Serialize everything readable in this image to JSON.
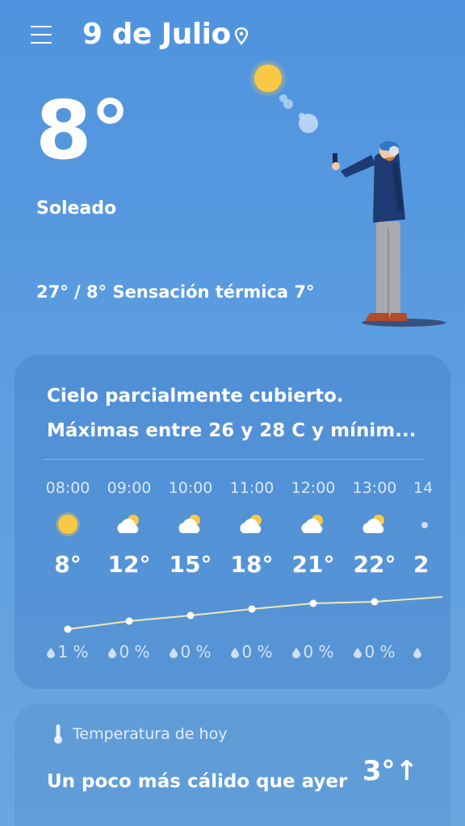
{
  "header": {
    "city": "9 de Julio",
    "menu_icon": "hamburger-menu-icon",
    "location_icon": "map-pin-icon"
  },
  "current": {
    "temperature": "8°",
    "condition": "Soleado",
    "range_feels_like": "27° / 8° Sensación térmica 7°"
  },
  "forecast_card": {
    "summary_line1": "Cielo parcialmente cubierto.",
    "summary_line2": "Máximas entre 26 y 28 C y mínim...",
    "hours": [
      {
        "time": "08:00",
        "icon": "sun-icon",
        "temp": "8°",
        "precip": "1 %"
      },
      {
        "time": "09:00",
        "icon": "partly-cloudy-icon",
        "temp": "12°",
        "precip": "0 %"
      },
      {
        "time": "10:00",
        "icon": "partly-cloudy-icon",
        "temp": "15°",
        "precip": "0 %"
      },
      {
        "time": "11:00",
        "icon": "partly-cloudy-icon",
        "temp": "18°",
        "precip": "0 %"
      },
      {
        "time": "12:00",
        "icon": "partly-cloudy-icon",
        "temp": "21°",
        "precip": "0 %"
      },
      {
        "time": "13:00",
        "icon": "partly-cloudy-icon",
        "temp": "22°",
        "precip": "0 %"
      },
      {
        "time": "14",
        "icon": "partly-cloudy-icon",
        "temp": "2",
        "precip": ""
      }
    ]
  },
  "today_card": {
    "title": "Temperatura de hoy",
    "text": "Un poco más cálido que ayer",
    "difference": "3°↑"
  },
  "colors": {
    "background_top": "#4f93de",
    "sun": "#f8c940",
    "chart_line": "#f2e7a0"
  }
}
